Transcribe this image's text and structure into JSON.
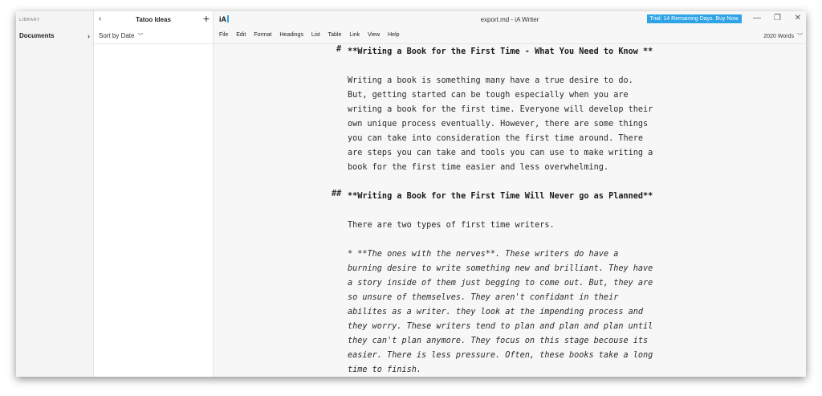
{
  "library": {
    "header": "LIBRARY",
    "item": "Documents"
  },
  "files": {
    "folder_title": "Tatoo Ideas",
    "sort_label": "Sort by Date"
  },
  "window": {
    "logo": "iA",
    "title": "export.md - iA Writer",
    "trial": "Trial: 14 Remaining Days. Buy Now."
  },
  "menu": [
    "File",
    "Edit",
    "Format",
    "Headings",
    "List",
    "Table",
    "Link",
    "View",
    "Help"
  ],
  "word_count": "2020 Words",
  "document": {
    "h1_marker": "#",
    "h1": "**Writing a Book for the First Time - What You Need to Know **",
    "p1": [
      "Writing a book is something many have a true desire to do.",
      "But, getting started can be tough especially when you are",
      "writing a book for the first time. Everyone will develop their",
      "own unique process eventually. However, there are some things",
      "you can take into consideration the first time around. There",
      "are steps you can take and tools you can use to make writing a",
      "book for the first time easier and less overwhelming."
    ],
    "h2_marker": "##",
    "h2": "**Writing a Book for the First Time Will Never go as Planned**",
    "p2": "There are two types of first time writers.",
    "bullet_lines": [
      "*   **The ones with the nerves**. These writers do have a",
      "burning desire to write something new and brilliant. They have",
      "a story inside of them just begging to come out. But, they are",
      "so unsure of themselves. They aren't confidant in their",
      "abilites as a writer. they look at the impending process and",
      "they worry. These writers tend to plan and plan and plan until",
      "they can't plan anymore. They focus on this stage becouse its",
      "easier. There is less pressure. Often, these books take a long",
      "time to finish."
    ]
  },
  "colors": {
    "accent": "#2ea3e6"
  }
}
